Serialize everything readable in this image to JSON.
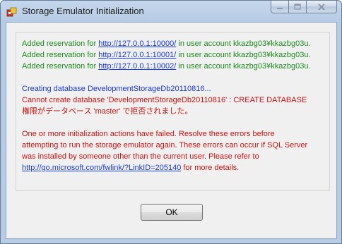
{
  "window": {
    "title": "Storage Emulator Initialization"
  },
  "log": {
    "reservations": [
      {
        "prefix": "Added reservation for ",
        "url": "http://127.0.0.1:10000/",
        "suffix": " in user account kkazbg03¥kkazbg03u."
      },
      {
        "prefix": "Added reservation for ",
        "url": "http://127.0.0.1:10001/",
        "suffix": " in user account kkazbg03¥kkazbg03u."
      },
      {
        "prefix": "Added reservation for ",
        "url": "http://127.0.0.1:10002/",
        "suffix": " in user account kkazbg03¥kkazbg03u."
      }
    ],
    "creating": "Creating database DevelopmentStorageDb20110816...",
    "error_line1": "Cannot create database 'DevelopmentStorageDb20110816' : CREATE DATABASE",
    "error_line2": "権限がデータベース 'master' で拒否されました。",
    "failure_lines": [
      "One or more initialization actions have failed. Resolve these errors before",
      "attempting to run the storage emulator again. These errors can occur if SQL Server",
      "was installed by someone other than the current user. Please refer to"
    ],
    "help_link": "http://go.microsoft.com/fwlink/?LinkID=205140",
    "help_suffix": " for more details."
  },
  "buttons": {
    "ok": "OK"
  },
  "colors": {
    "success": "#1c8a1c",
    "info": "#1a36d8",
    "error": "#cc1111",
    "link": "#1a3ad8"
  },
  "icons": [
    "app-icon",
    "minimize-icon",
    "maximize-icon",
    "close-icon"
  ]
}
